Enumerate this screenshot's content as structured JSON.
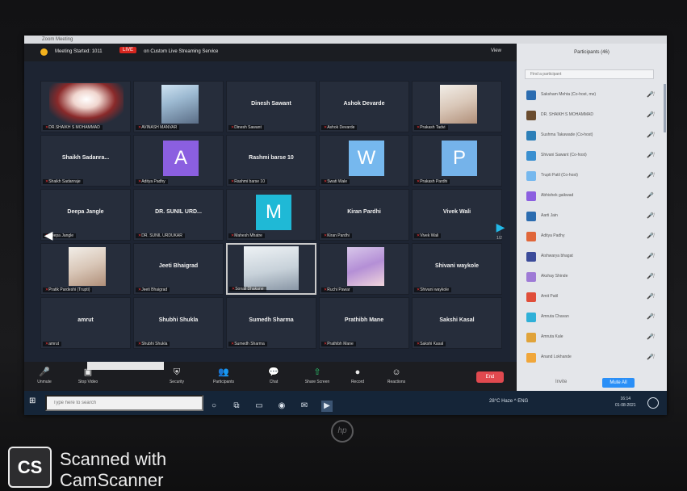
{
  "window_title": "Zoom Meeting",
  "meeting": {
    "title": "Meeting Started: 1011",
    "live_badge": "LIVE",
    "live_text": "on Custom Live Streaming Service",
    "view_label": "View"
  },
  "tiles": [
    {
      "name": "",
      "label": "DR.SHAIKH S MOHAMMAD"
    },
    {
      "name": "",
      "label": "AVINASH MANVAR"
    },
    {
      "name": "Dinesh Sawant",
      "label": "Dinesh Sawant"
    },
    {
      "name": "Ashok Devarde",
      "label": "Ashok Devarde"
    },
    {
      "name": "",
      "label": "Prakash Tadvi"
    },
    {
      "name": "Shaikh Sadanra...",
      "label": "Shaikh Sadanraje"
    },
    {
      "name": "A",
      "label": "Aditya Padhy"
    },
    {
      "name": "Rashmi barse 10",
      "label": "Rashmi barse 10"
    },
    {
      "name": "W",
      "label": "Swati Wale"
    },
    {
      "name": "P",
      "label": "Prakash Pardhi"
    },
    {
      "name": "Deepa Jangle",
      "label": "Deepa Jangle"
    },
    {
      "name": "DR. SUNIL URD...",
      "label": "DR. SUNIL URDUKAR"
    },
    {
      "name": "M",
      "label": "Mahesh Mhatre"
    },
    {
      "name": "Kiran Pardhi",
      "label": "Kiran Pardhi"
    },
    {
      "name": "Vivek Wali",
      "label": "Vivek Wali"
    },
    {
      "name": "",
      "label": "Pratik Pardeshi (Trupti)"
    },
    {
      "name": "Jeeti Bhaigrad",
      "label": "Jeeti Bhaigrad"
    },
    {
      "name": "",
      "label": "Sonali Dhakane"
    },
    {
      "name": "",
      "label": "Ruchi Pawar"
    },
    {
      "name": "Shivani waykole",
      "label": "Shivani waykole"
    },
    {
      "name": "amrut",
      "label": "amrut"
    },
    {
      "name": "Shubhi Shukla",
      "label": "Shubhi Shukla"
    },
    {
      "name": "Sumedh Sharma",
      "label": "Sumedh Sharma"
    },
    {
      "name": "Prathibh Mane",
      "label": "Prathibh Mane"
    },
    {
      "name": "Sakshi Kasal",
      "label": "Sakshi Kasal"
    }
  ],
  "nav": {
    "left_arrow": "◀",
    "right_arrow": "▶",
    "page": "1/2"
  },
  "toolbar": {
    "unmute": "Unmute",
    "stop_video": "Stop Video",
    "security": "Security",
    "participants": "Participants",
    "chat": "Chat",
    "share_screen": "Share Screen",
    "record": "Record",
    "reactions": "Reactions",
    "end": "End"
  },
  "participants_panel": {
    "title": "Participants (46)",
    "search_placeholder": "Find a participant",
    "items": [
      {
        "name": "Saksham Mehta (Co-host, me)",
        "color": "#2b6cb0"
      },
      {
        "name": "DR. SHAIKH S MOHAMMAD",
        "color": "#6a4c2f"
      },
      {
        "name": "Sushma Takawade (Co-host)",
        "color": "#2c7fb8"
      },
      {
        "name": "Shivani Sawant (Co-host)",
        "color": "#3a8fd0"
      },
      {
        "name": "Trupti Patil (Co-host)",
        "color": "#76b8ee"
      },
      {
        "name": "Abhishek gaikwad",
        "color": "#8b5fe0"
      },
      {
        "name": "Aarti Jain",
        "color": "#2b6cb0"
      },
      {
        "name": "Aditya Padhy",
        "color": "#e0663a"
      },
      {
        "name": "Aishwarya bhagat",
        "color": "#3b4b9a"
      },
      {
        "name": "Akshay Shinde",
        "color": "#9e7ad6"
      },
      {
        "name": "Amit Patil",
        "color": "#e04e3a"
      },
      {
        "name": "Amruta Chavan",
        "color": "#2fb0d8"
      },
      {
        "name": "Amruta Kale",
        "color": "#e0a33a"
      },
      {
        "name": "Anand Lokhande",
        "color": "#f0a63a"
      }
    ],
    "invite": "Invite",
    "mute_all": "Mute All"
  },
  "taskbar": {
    "search_placeholder": "Type here to search",
    "tray": "28°C  Haze  ^  ENG",
    "time": "16:14",
    "date": "01-08-2021"
  },
  "brand": {
    "hp": "hp"
  },
  "watermark": {
    "cs": "CS",
    "line1": "Scanned with",
    "line2": "CamScanner"
  }
}
